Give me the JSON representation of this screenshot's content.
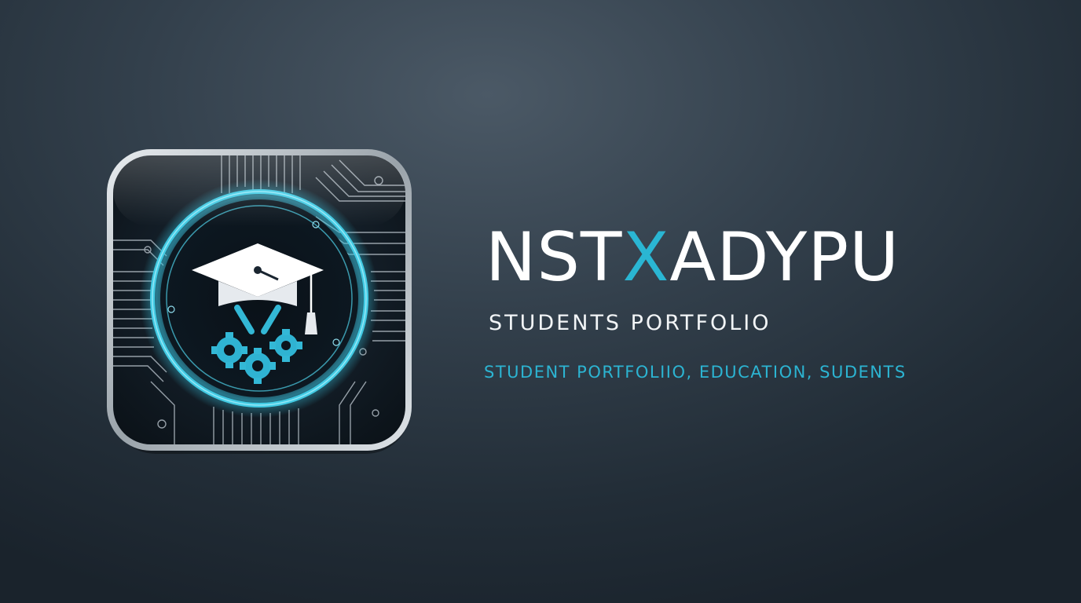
{
  "logo": {
    "icon": "graduation-cap-with-gears-circuit-icon",
    "frame_color": "#c9cfd4",
    "ring_color": "#3fc6e0"
  },
  "brand": {
    "title_part1": "NST",
    "title_accent": "X",
    "title_part2": "ADYPU",
    "accent_color": "#2ab6d3"
  },
  "subtitle": "STUDENTS PORTFOLIO",
  "tagline": "STUDENT PORTFOLIIO, EDUCATION, SUDENTS",
  "colors": {
    "background": "#2e3a45",
    "title": "#ffffff",
    "tagline": "#2cb4d2"
  }
}
